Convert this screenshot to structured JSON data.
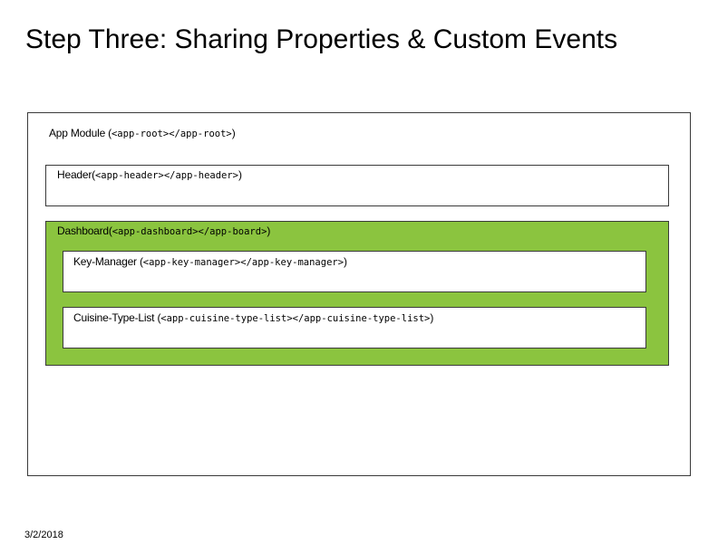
{
  "title": "Step Three: Sharing Properties & Custom Events",
  "diagram": {
    "app_module": {
      "name": "App Module",
      "prefix": " (",
      "tag": "<app-root></app-root>",
      "suffix": ")"
    },
    "header": {
      "name": "Header",
      "prefix": "(",
      "tag": "<app-header></app-header>",
      "suffix": ")"
    },
    "dashboard": {
      "name": "Dashboard",
      "prefix": "(",
      "tag": "<app-dashboard></app-board>",
      "suffix": ")",
      "fill_color": "#8bc43f"
    },
    "key_manager": {
      "name": "Key-Manager",
      "prefix": " (",
      "tag": "<app-key-manager></app-key-manager>",
      "suffix": ")"
    },
    "cuisine_type_list": {
      "name": "Cuisine-Type-List",
      "prefix": " (",
      "tag": "<app-cuisine-type-list></app-cuisine-type-list>",
      "suffix": ")"
    }
  },
  "footer": {
    "date": "3/2/2018"
  }
}
